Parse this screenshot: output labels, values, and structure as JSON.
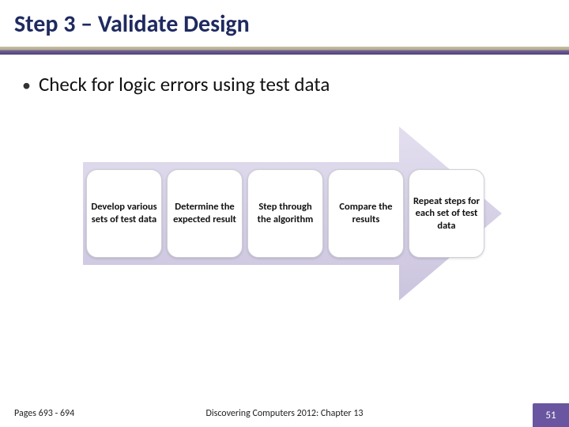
{
  "title": "Step 3 – Validate Design",
  "bullet": {
    "marker": "•",
    "text": "Check for logic errors using test data"
  },
  "steps": [
    "Develop various sets of test data",
    "Determine the expected result",
    "Step through the algorithm",
    "Compare the results",
    "Repeat steps for each set of test data"
  ],
  "footer": {
    "left": "Pages 693 - 694",
    "center": "Discovering Computers 2012: Chapter 13",
    "page": "51"
  },
  "colors": {
    "accent": "#6a56a0",
    "arrow": "#d9d4e6"
  }
}
